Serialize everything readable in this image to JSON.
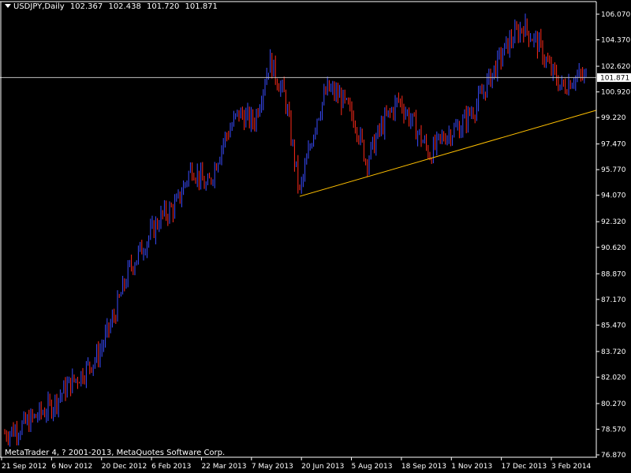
{
  "header": {
    "symbol": "USDJPY,Daily",
    "open": "102.367",
    "high": "102.438",
    "low": "101.720",
    "close": "101.871"
  },
  "footer": {
    "copyright": "MetaTrader 4, ? 2001-2013, MetaQuotes Software Corp."
  },
  "colors": {
    "background": "#000000",
    "bull": "#3a4cff",
    "bear": "#ff2a1a",
    "axis": "#ffffff",
    "trendline": "#ffc000",
    "price_line": "#c0c0c0"
  },
  "chart_data": {
    "type": "candlestick",
    "title": "",
    "y_ticks": [
      "106.070",
      "104.370",
      "102.620",
      "100.920",
      "99.220",
      "97.470",
      "95.770",
      "94.070",
      "92.320",
      "90.620",
      "88.870",
      "87.170",
      "85.470",
      "83.720",
      "82.020",
      "80.270",
      "78.570",
      "76.870"
    ],
    "ylim": [
      76.87,
      106.07
    ],
    "x_ticks": [
      "21 Sep 2012",
      "6 Nov 2012",
      "20 Dec 2012",
      "6 Feb 2013",
      "22 Mar 2013",
      "7 May 2013",
      "20 Jun 2013",
      "5 Aug 2013",
      "18 Sep 2013",
      "1 Nov 2013",
      "17 Dec 2013",
      "3 Feb 2014"
    ],
    "current_price": "101.871",
    "trendline": {
      "from": {
        "date": "2013-06-13",
        "price": 94.0
      },
      "to": {
        "date": "2014-02-26",
        "price": 99.6
      }
    },
    "close_path": [
      {
        "date": "2012-09-21",
        "close": 78.3
      },
      {
        "date": "2012-10-05",
        "close": 78.7
      },
      {
        "date": "2012-10-19",
        "close": 79.4
      },
      {
        "date": "2012-11-02",
        "close": 80.1
      },
      {
        "date": "2012-11-16",
        "close": 81.4
      },
      {
        "date": "2012-11-30",
        "close": 82.3
      },
      {
        "date": "2012-12-14",
        "close": 83.5
      },
      {
        "date": "2012-12-28",
        "close": 86.0
      },
      {
        "date": "2013-01-11",
        "close": 89.2
      },
      {
        "date": "2013-01-25",
        "close": 90.9
      },
      {
        "date": "2013-02-08",
        "close": 92.6
      },
      {
        "date": "2013-02-22",
        "close": 93.4
      },
      {
        "date": "2013-03-08",
        "close": 96.0
      },
      {
        "date": "2013-03-22",
        "close": 94.5
      },
      {
        "date": "2013-04-05",
        "close": 97.6
      },
      {
        "date": "2013-04-19",
        "close": 99.5
      },
      {
        "date": "2013-05-03",
        "close": 98.9
      },
      {
        "date": "2013-05-17",
        "close": 103.0
      },
      {
        "date": "2013-05-31",
        "close": 100.5
      },
      {
        "date": "2013-06-13",
        "close": 94.2
      },
      {
        "date": "2013-06-28",
        "close": 99.2
      },
      {
        "date": "2013-07-08",
        "close": 101.1
      },
      {
        "date": "2013-07-19",
        "close": 100.6
      },
      {
        "date": "2013-08-02",
        "close": 99.0
      },
      {
        "date": "2013-08-12",
        "close": 96.3
      },
      {
        "date": "2013-08-26",
        "close": 98.7
      },
      {
        "date": "2013-09-10",
        "close": 100.4
      },
      {
        "date": "2013-09-20",
        "close": 99.2
      },
      {
        "date": "2013-10-08",
        "close": 96.8
      },
      {
        "date": "2013-10-22",
        "close": 98.1
      },
      {
        "date": "2013-11-04",
        "close": 98.6
      },
      {
        "date": "2013-11-20",
        "close": 100.2
      },
      {
        "date": "2013-12-04",
        "close": 102.3
      },
      {
        "date": "2013-12-18",
        "close": 104.2
      },
      {
        "date": "2013-12-31",
        "close": 105.3
      },
      {
        "date": "2014-01-14",
        "close": 104.0
      },
      {
        "date": "2014-01-24",
        "close": 102.4
      },
      {
        "date": "2014-02-04",
        "close": 101.2
      },
      {
        "date": "2014-02-14",
        "close": 101.9
      },
      {
        "date": "2014-02-26",
        "close": 101.87
      }
    ]
  }
}
